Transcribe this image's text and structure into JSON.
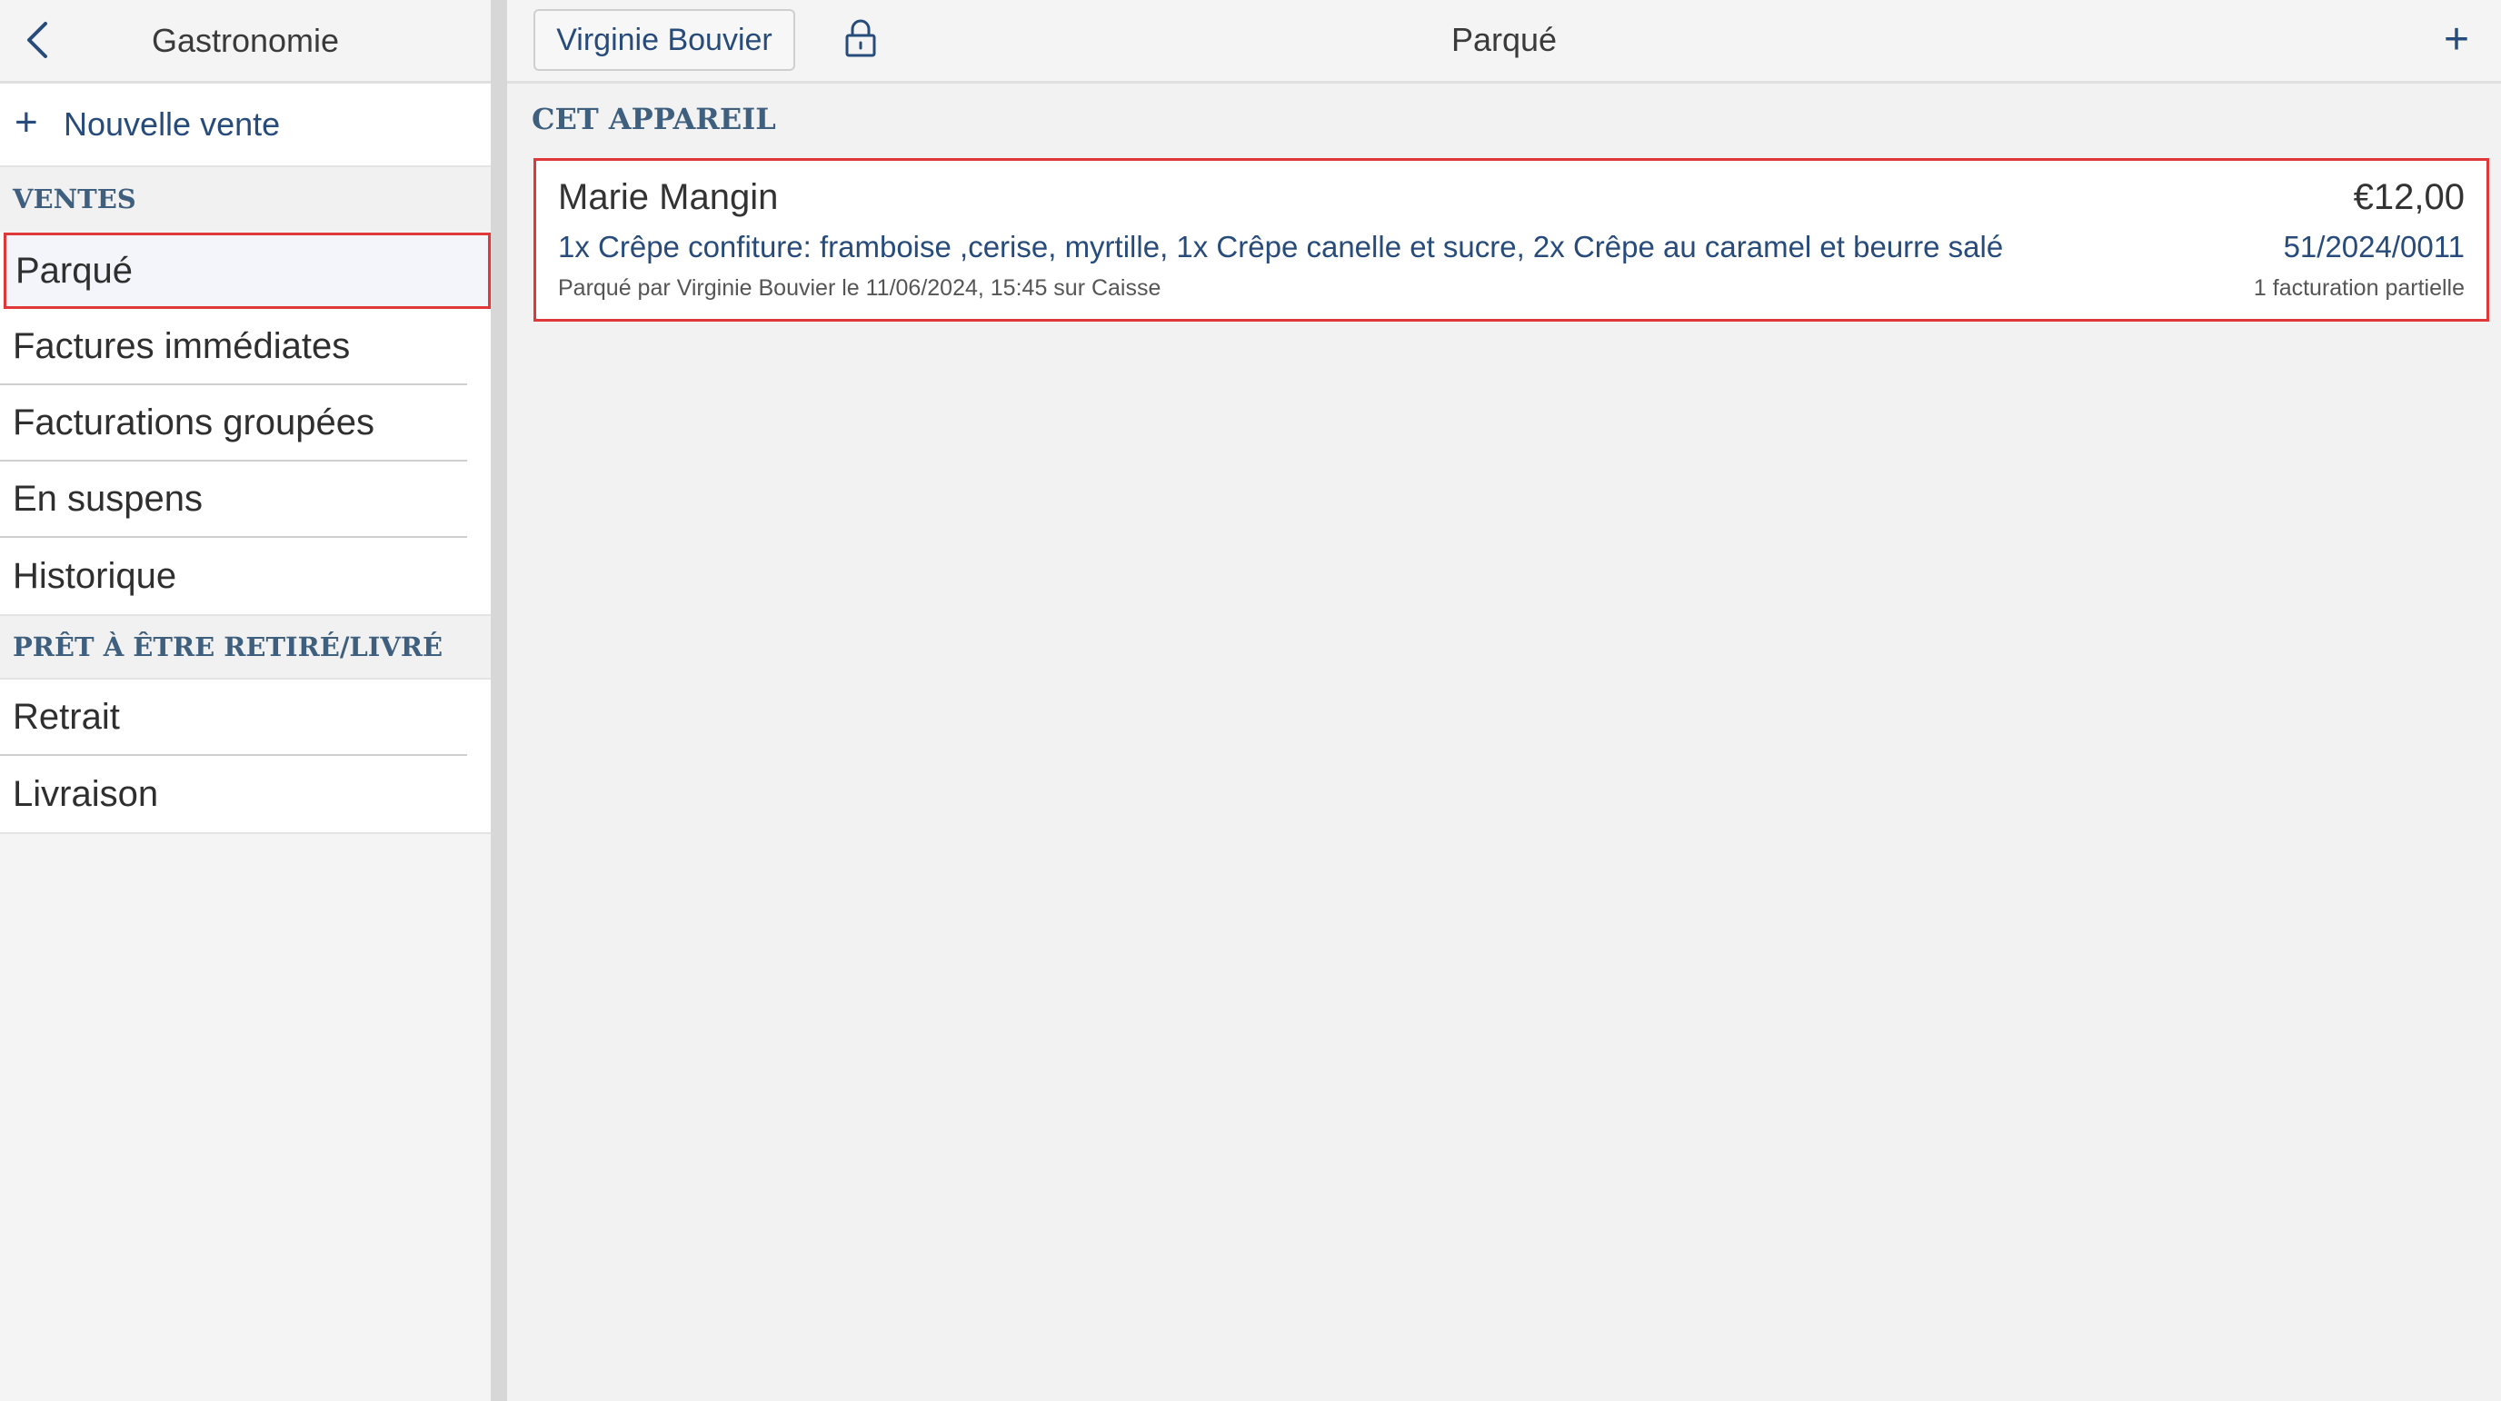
{
  "sidebar": {
    "title": "Gastronomie",
    "new_sale": "Nouvelle vente",
    "section_sales": "VENTES",
    "sales_items": [
      {
        "label": "Parqué"
      },
      {
        "label": "Factures immédiates"
      },
      {
        "label": "Facturations groupées"
      },
      {
        "label": "En suspens"
      },
      {
        "label": "Historique"
      }
    ],
    "section_ready": "PRÊT À ÊTRE RETIRÉ/LIVRÉ",
    "ready_items": [
      {
        "label": "Retrait"
      },
      {
        "label": "Livraison"
      }
    ]
  },
  "header": {
    "user": "Virginie Bouvier",
    "title": "Parqué",
    "add_label": "+"
  },
  "main": {
    "section_title": "CET APPAREIL",
    "orders": [
      {
        "customer": "Marie Mangin",
        "amount": "€12,00",
        "items": "1x Crêpe confiture: framboise ,cerise, myrtille, 1x Crêpe canelle et sucre, 2x Crêpe au caramel et beurre salé",
        "number": "51/2024/0011",
        "parked_info": "Parqué par Virginie Bouvier le 11/06/2024, 15:45 sur Caisse",
        "billing_info": "1 facturation partielle"
      }
    ]
  },
  "colors": {
    "accent": "#274b7a",
    "section": "#3f5f7f",
    "highlight": "#e03838"
  }
}
